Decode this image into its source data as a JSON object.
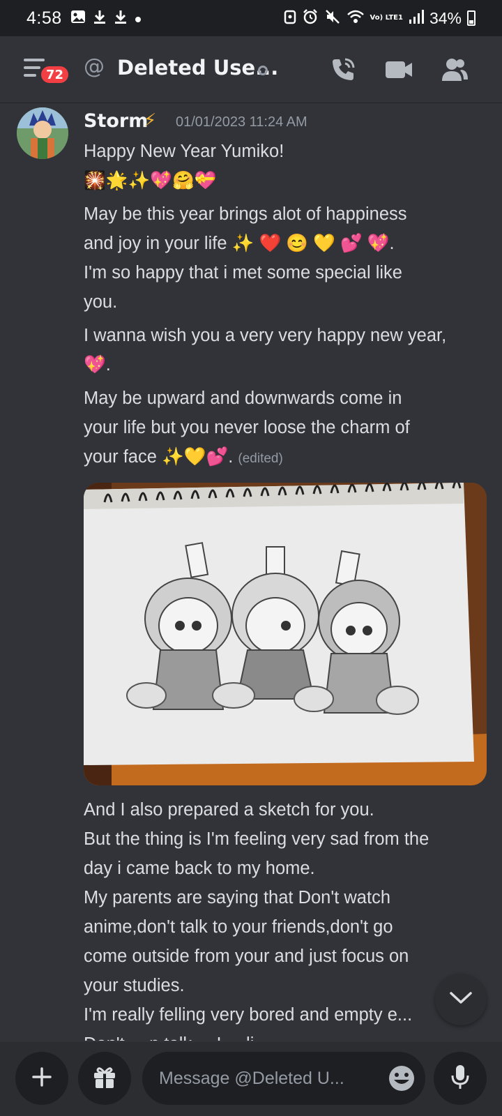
{
  "status_bar": {
    "time": "4:58",
    "battery": "34%",
    "network": "Vo) LTE1"
  },
  "header": {
    "badge_count": "72",
    "title": "Deleted Use..."
  },
  "message": {
    "author": "Storm",
    "author_flair": "⚡",
    "timestamp": "01/01/2023 11:24 AM",
    "line1": "Happy New Year Yumiko!",
    "line2_emoji": "🎇🌟✨💖🤗💝",
    "para1a": "May be this year brings alot of happiness",
    "para1b": "and joy in your life ✨ ❤️ 😊 💛 💕 💖.",
    "para1c": "I'm so happy that i met some special like",
    "para1d": "you.",
    "para2a": "I wanna wish you a very very happy new year,",
    "para2b": "💖.",
    "para3a": "May be upward and downwards come in",
    "para3b": "your life but you never loose the charm of",
    "para3c": "your face ✨💛💕.",
    "edited_label": "(edited)",
    "attachment_label": "Sketch image",
    "para4": [
      "And I also prepared a sketch for you.",
      "But the thing is I'm feeling very sad from the",
      "day i came back to my home.",
      "My parents are saying that Don't watch",
      "anime,don't talk to your friends,don't go",
      "come outside from your and just focus on",
      "your studies.",
      "I'm really felling very bored and empty e...",
      "Don't ... n talk ... I ... li"
    ]
  },
  "composer": {
    "placeholder": "Message @Deleted U..."
  },
  "icons": {
    "menu": "hamburger-icon",
    "at": "at-icon",
    "call": "phone-call-icon",
    "video": "video-camera-icon",
    "members": "members-icon",
    "add": "plus-icon",
    "gift": "gift-icon",
    "emoji": "emoji-icon",
    "mic": "microphone-icon",
    "scroll": "chevron-down-icon"
  },
  "colors": {
    "background": "#313338",
    "badge": "#f23f43",
    "input_bg": "#1e1f22",
    "text": "#dbdee1",
    "muted": "#949ba4"
  }
}
